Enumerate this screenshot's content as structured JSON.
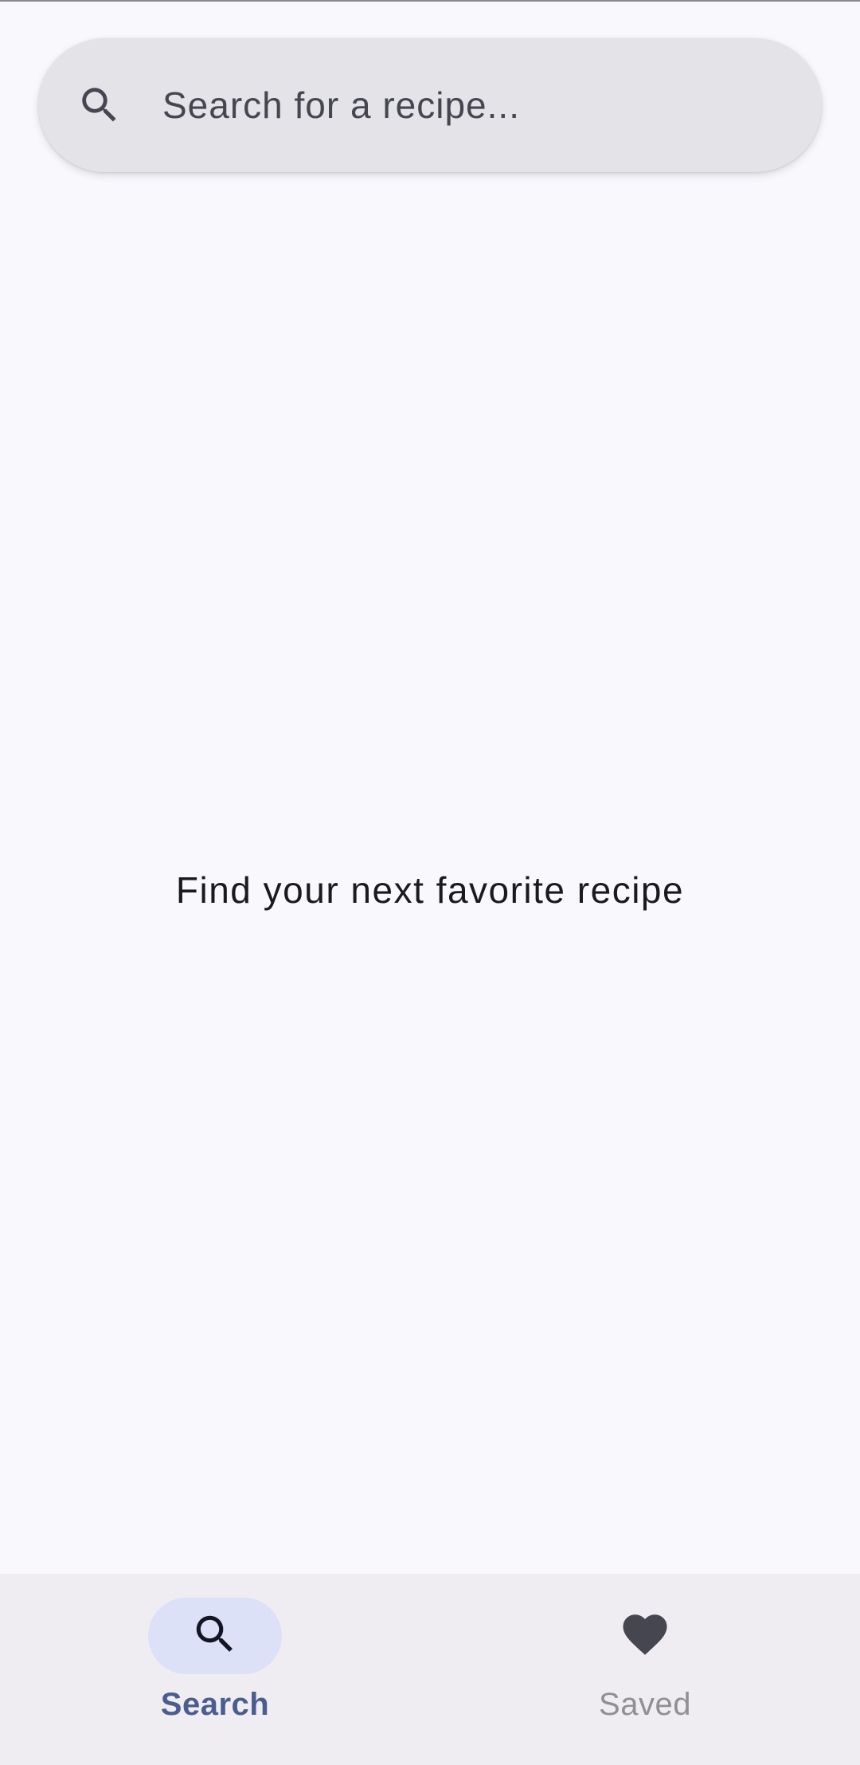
{
  "search": {
    "placeholder": "Search for a recipe...",
    "value": "",
    "icon": "search-icon"
  },
  "main": {
    "empty_message": "Find your next favorite recipe"
  },
  "bottom_nav": {
    "items": [
      {
        "label": "Search",
        "icon": "search-icon",
        "selected": true
      },
      {
        "label": "Saved",
        "icon": "heart-icon",
        "selected": false
      }
    ]
  },
  "colors": {
    "background": "#f9f8fd",
    "search_bar": "#e4e3e8",
    "nav_background": "#efedf2",
    "nav_active_pill": "#dde1f8",
    "nav_active_label": "#4b5d8f",
    "nav_inactive_label": "#8f8f94"
  }
}
